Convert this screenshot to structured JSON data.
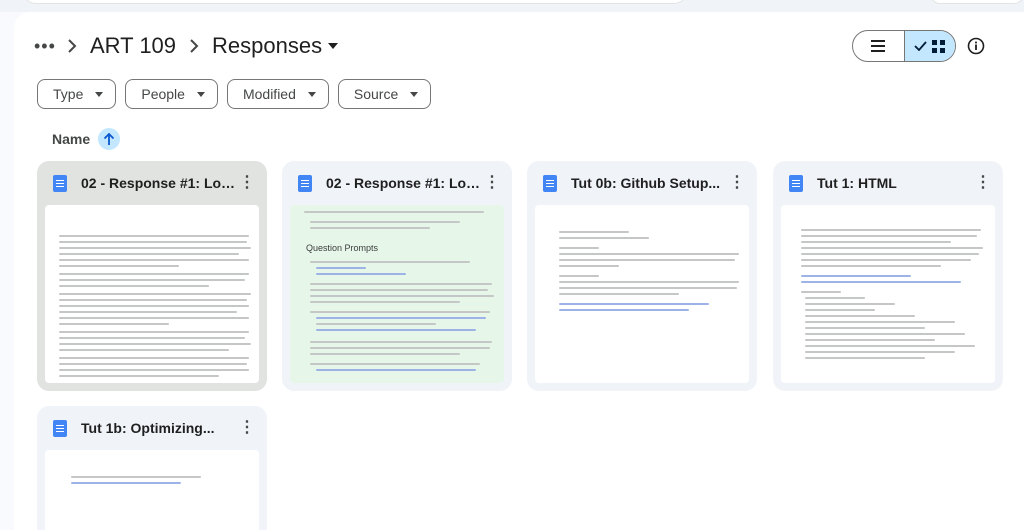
{
  "breadcrumb": {
    "more_label": "•••",
    "parent": "ART 109",
    "current": "Responses"
  },
  "filters": [
    {
      "label": "Type"
    },
    {
      "label": "People"
    },
    {
      "label": "Modified"
    },
    {
      "label": "Source"
    }
  ],
  "sort": {
    "label": "Name",
    "direction": "ascending"
  },
  "view": {
    "mode": "grid"
  },
  "files": [
    {
      "title": "02 - Response #1: Lo-...",
      "icon": "google-docs-icon",
      "selected": true
    },
    {
      "title": "02 - Response #1: Lo-...",
      "icon": "google-docs-icon",
      "selected": false,
      "thumb_heading": "Question Prompts"
    },
    {
      "title": "Tut 0b: Github Setup...",
      "icon": "google-docs-icon",
      "selected": false
    },
    {
      "title": "Tut 1: HTML",
      "icon": "google-docs-icon",
      "selected": false
    },
    {
      "title": "Tut 1b: Optimizing...",
      "icon": "google-docs-icon",
      "selected": false
    }
  ],
  "colors": {
    "accent": "#c2e7ff",
    "doc_icon": "#4285f4",
    "card_bg": "#f0f4f9",
    "card_selected_bg": "#e1e3e1"
  }
}
